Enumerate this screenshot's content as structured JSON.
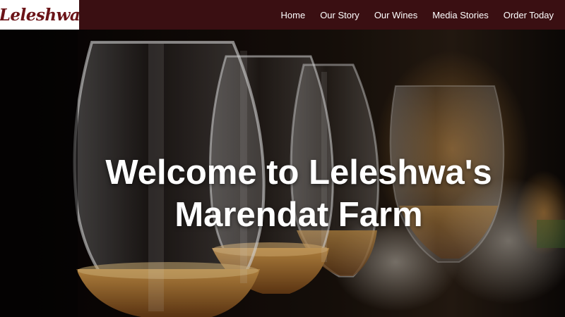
{
  "brand": {
    "logo_text": "Leleshwa",
    "colors": {
      "header_bg": "#3a0f12",
      "logo_text": "#6b1418",
      "nav_text": "#ffffff"
    }
  },
  "nav": {
    "items": [
      {
        "label": "Home"
      },
      {
        "label": "Our Story"
      },
      {
        "label": "Our Wines"
      },
      {
        "label": "Media Stories"
      },
      {
        "label": "Order Today"
      }
    ]
  },
  "hero": {
    "title_line1": "Welcome to Leleshwa's",
    "title_line2": "Marendat Farm",
    "background": "wine-glasses-photo"
  }
}
